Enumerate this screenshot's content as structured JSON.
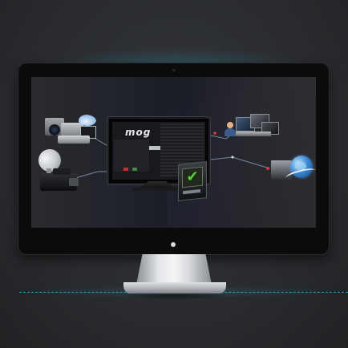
{
  "mini_app": {
    "logo_text": "mog"
  },
  "icons": {
    "check": "✔"
  },
  "colors": {
    "accent_line": "#2aa9c8",
    "connector": "#7a8aa0",
    "check_green": "#54d43a",
    "stop_red": "#c4302b",
    "go_green": "#3c8f3a"
  }
}
